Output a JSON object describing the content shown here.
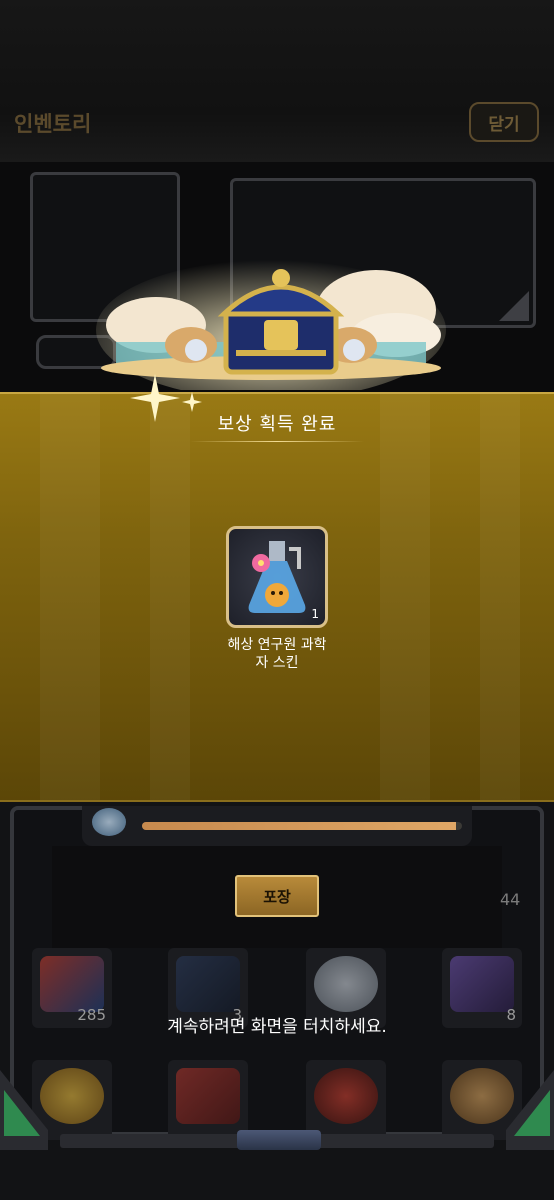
{
  "header": {
    "title": "인벤토리",
    "close_label": "닫기"
  },
  "reward": {
    "title": "보상 획득 완료",
    "item": {
      "name": "해상 연구원 과학자 스킨",
      "name_line1": "해상 연구원 과학",
      "name_line2": "자 스킨",
      "count": "1",
      "icon": "potion-flask-icon"
    }
  },
  "inventory": {
    "progress_fraction": 0.98,
    "pack_label": "포장",
    "side_count": "44",
    "row1": [
      {
        "icon": "christmas-card-icon",
        "count": "285"
      },
      {
        "icon": "dark-rose-icon",
        "count": "3"
      },
      {
        "icon": "silver-coin-icon",
        "count": ""
      },
      {
        "icon": "photo-frame-icon",
        "count": "8"
      }
    ],
    "row2": [
      {
        "icon": "gold-coin-icon",
        "count": ""
      },
      {
        "icon": "red-ticket-icon",
        "count": ""
      },
      {
        "icon": "roulette-icon",
        "count": ""
      },
      {
        "icon": "palette-icon",
        "count": ""
      }
    ]
  },
  "overlay": {
    "touch_message": "계속하려면 화면을 터치하세요."
  },
  "colors": {
    "gold_band": "#7f640e",
    "frame_gold": "#d9c089",
    "accent_green": "#2f8a4f"
  }
}
